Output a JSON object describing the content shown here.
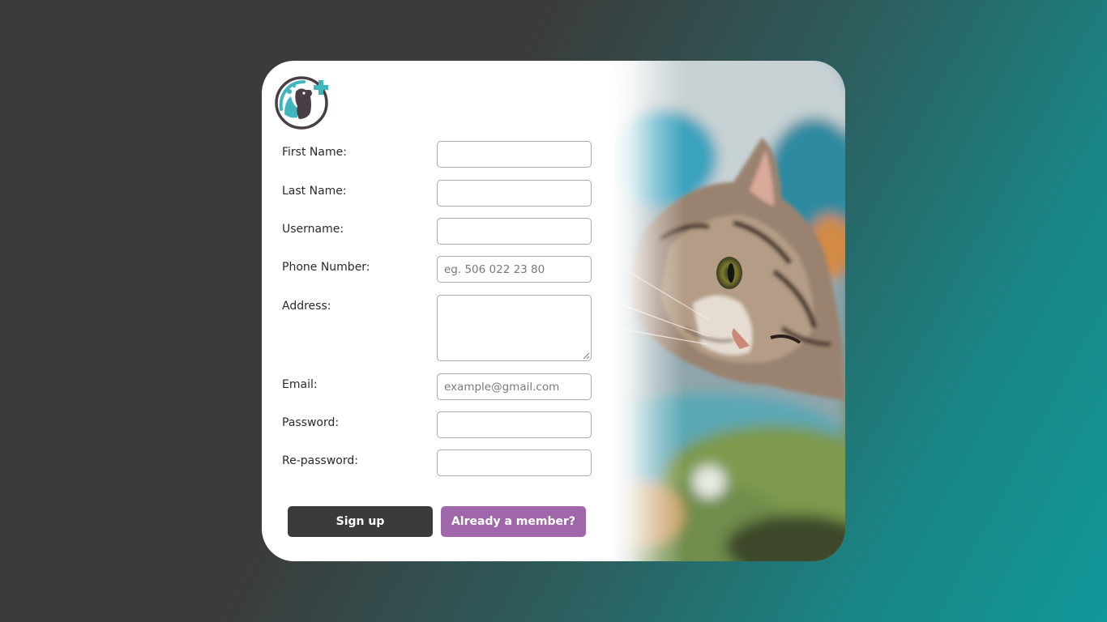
{
  "form": {
    "fields": [
      {
        "label": "First Name:",
        "value": "",
        "placeholder": ""
      },
      {
        "label": "Last Name:",
        "value": "",
        "placeholder": ""
      },
      {
        "label": "Username:",
        "value": "",
        "placeholder": ""
      },
      {
        "label": "Phone Number:",
        "value": "",
        "placeholder": "eg. 506 022 23 80"
      },
      {
        "label": "Address:",
        "value": "",
        "placeholder": ""
      },
      {
        "label": "Email:",
        "value": "",
        "placeholder": "example@gmail.com"
      },
      {
        "label": "Password:",
        "value": "",
        "placeholder": ""
      },
      {
        "label": "Re-password:",
        "value": "",
        "placeholder": ""
      }
    ]
  },
  "buttons": {
    "signup": "Sign up",
    "member": "Already a member?"
  },
  "colors": {
    "signup_bg": "#3b3b3b",
    "member_bg": "#a066aa",
    "accent_teal": "#3fb6bd"
  },
  "icons": {
    "logo": "pet-clinic-logo",
    "photo": "cat-photo"
  }
}
